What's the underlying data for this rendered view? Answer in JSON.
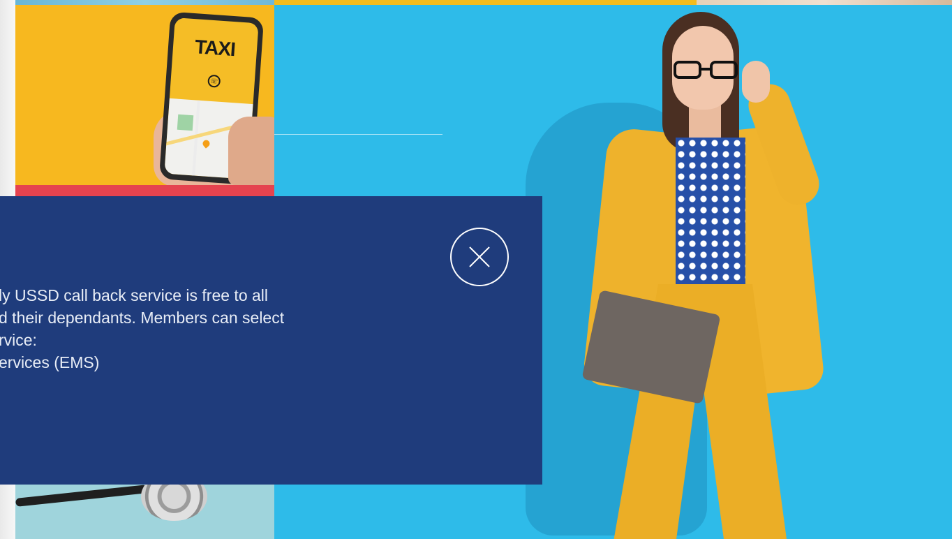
{
  "tiles": {
    "taxi": {
      "label": "TAXI"
    }
  },
  "modal": {
    "lines": [
      "ly USSD call back service is free to all",
      "d their dependants. Members can select",
      "rvice:",
      "ervices (EMS)"
    ],
    "close_icon": "close-icon"
  },
  "colors": {
    "modal_bg": "#1f3c7c",
    "hero_bg": "#2ebbe9",
    "taxi_bg": "#f7b81f",
    "red_tile": "#e5434f"
  }
}
